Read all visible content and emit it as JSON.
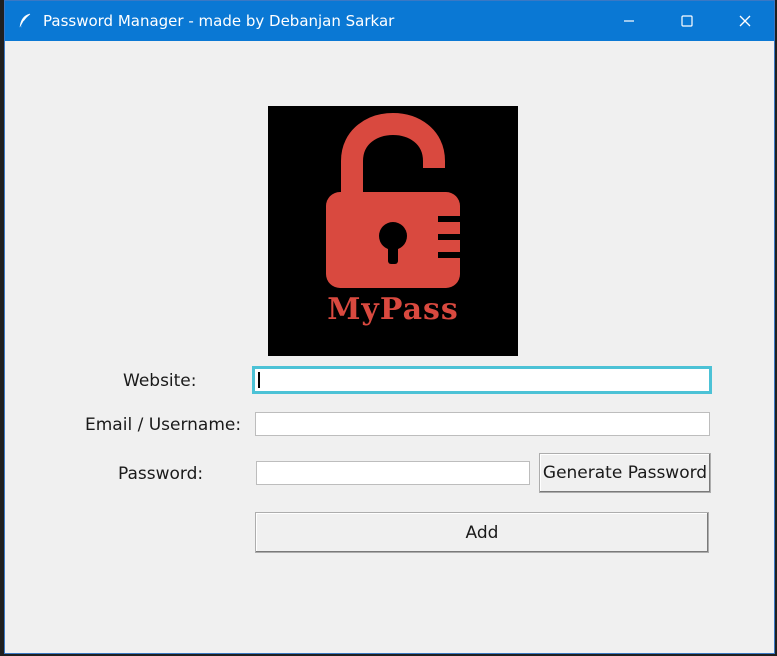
{
  "window": {
    "title": "Password Manager - made by Debanjan Sarkar",
    "icon": "feather-icon",
    "controls": {
      "minimize_icon": "minimize-icon",
      "maximize_icon": "maximize-icon",
      "close_icon": "close-icon"
    }
  },
  "logo": {
    "text": "MyPass",
    "icon": "unlocked-padlock-icon",
    "color": "#d9493f",
    "background": "#000000"
  },
  "form": {
    "website": {
      "label": "Website:",
      "value": "",
      "focused": true
    },
    "email": {
      "label": "Email / Username:",
      "value": ""
    },
    "password": {
      "label": "Password:",
      "value": ""
    },
    "generate_button": "Generate Password",
    "add_button": "Add"
  },
  "colors": {
    "titlebar": "#0a78d4",
    "focus_border": "#4cc2d6",
    "window_bg": "#f0f0f0"
  }
}
